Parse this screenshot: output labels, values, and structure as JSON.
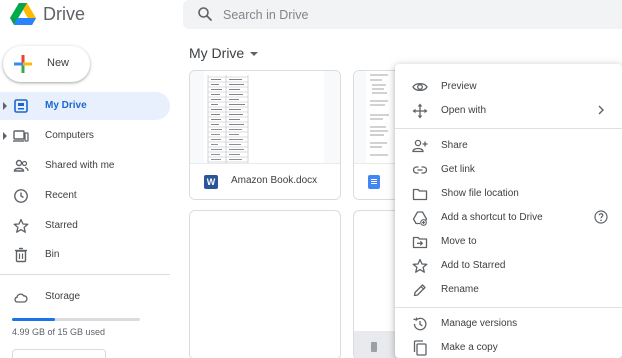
{
  "header": {
    "app_title": "Drive",
    "search_placeholder": "Search in Drive",
    "logo_icon": "google-drive-logo",
    "search_icon": "search-icon"
  },
  "sidebar": {
    "new_label": "New",
    "items": [
      {
        "label": "My Drive",
        "icon": "my-drive-icon",
        "active": true,
        "expandable": true
      },
      {
        "label": "Computers",
        "icon": "computers-icon",
        "active": false,
        "expandable": true
      },
      {
        "label": "Shared with me",
        "icon": "shared-icon",
        "active": false,
        "expandable": false
      },
      {
        "label": "Recent",
        "icon": "clock-icon",
        "active": false,
        "expandable": false
      },
      {
        "label": "Starred",
        "icon": "star-icon",
        "active": false,
        "expandable": false
      },
      {
        "label": "Bin",
        "icon": "trash-icon",
        "active": false,
        "expandable": false
      }
    ],
    "storage": {
      "label": "Storage",
      "icon": "cloud-icon",
      "usage_text": "4.99 GB of 15 GB used",
      "used_fraction": 0.333
    }
  },
  "main": {
    "breadcrumb": "My Drive",
    "files": [
      {
        "name": "Amazon Book.docx",
        "type": "word",
        "badge": "W"
      },
      {
        "name": "",
        "type": "google-doc",
        "badge": ""
      }
    ]
  },
  "context_menu": {
    "items": [
      {
        "label": "Preview",
        "icon": "eye-icon"
      },
      {
        "label": "Open with",
        "icon": "move-arrows-icon",
        "submenu": true
      },
      {
        "label": "Share",
        "icon": "person-add-icon"
      },
      {
        "label": "Get link",
        "icon": "link-icon"
      },
      {
        "label": "Show file location",
        "icon": "folder-icon"
      },
      {
        "label": "Add a shortcut to Drive",
        "icon": "shortcut-icon",
        "help": true
      },
      {
        "label": "Move to",
        "icon": "move-to-icon"
      },
      {
        "label": "Add to Starred",
        "icon": "star-icon"
      },
      {
        "label": "Rename",
        "icon": "pencil-icon"
      },
      {
        "label": "Manage versions",
        "icon": "history-icon"
      },
      {
        "label": "Make a copy",
        "icon": "copy-icon"
      }
    ]
  },
  "colors": {
    "accent": "#1a73e8",
    "active_bg": "#e8f0fe",
    "active_text": "#1967d2",
    "search_bg": "#f1f3f4",
    "word_blue": "#2a5699",
    "docs_blue": "#4285f4"
  }
}
